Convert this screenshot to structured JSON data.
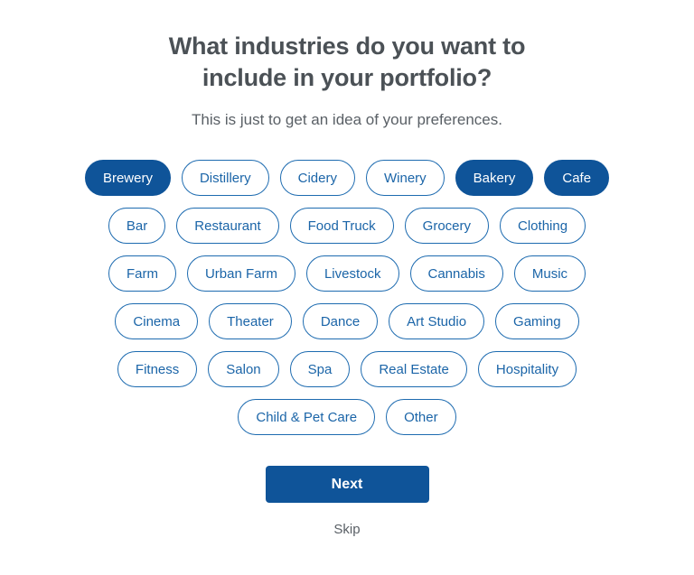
{
  "heading": "What industries do you want to include in your portfolio?",
  "subheading": "This is just to get an idea of your preferences.",
  "colors": {
    "accent": "#0f5499",
    "chip_border": "#1d6bb0",
    "chip_text": "#1b65a8",
    "heading_text": "#4b5156",
    "subheading_text": "#5a6066",
    "background": "#ffffff",
    "selected_chip_text": "#ffffff"
  },
  "chip_rows": [
    [
      {
        "label": "Brewery",
        "selected": true
      },
      {
        "label": "Distillery",
        "selected": false
      },
      {
        "label": "Cidery",
        "selected": false
      },
      {
        "label": "Winery",
        "selected": false
      },
      {
        "label": "Bakery",
        "selected": true
      },
      {
        "label": "Cafe",
        "selected": true
      }
    ],
    [
      {
        "label": "Bar",
        "selected": false
      },
      {
        "label": "Restaurant",
        "selected": false
      },
      {
        "label": "Food Truck",
        "selected": false
      },
      {
        "label": "Grocery",
        "selected": false
      },
      {
        "label": "Clothing",
        "selected": false
      }
    ],
    [
      {
        "label": "Farm",
        "selected": false
      },
      {
        "label": "Urban Farm",
        "selected": false
      },
      {
        "label": "Livestock",
        "selected": false
      },
      {
        "label": "Cannabis",
        "selected": false
      },
      {
        "label": "Music",
        "selected": false
      }
    ],
    [
      {
        "label": "Cinema",
        "selected": false
      },
      {
        "label": "Theater",
        "selected": false
      },
      {
        "label": "Dance",
        "selected": false
      },
      {
        "label": "Art Studio",
        "selected": false
      },
      {
        "label": "Gaming",
        "selected": false
      }
    ],
    [
      {
        "label": "Fitness",
        "selected": false
      },
      {
        "label": "Salon",
        "selected": false
      },
      {
        "label": "Spa",
        "selected": false
      },
      {
        "label": "Real Estate",
        "selected": false
      },
      {
        "label": "Hospitality",
        "selected": false
      }
    ],
    [
      {
        "label": "Child & Pet Care",
        "selected": false
      },
      {
        "label": "Other",
        "selected": false
      }
    ]
  ],
  "actions": {
    "next_label": "Next",
    "skip_label": "Skip"
  }
}
